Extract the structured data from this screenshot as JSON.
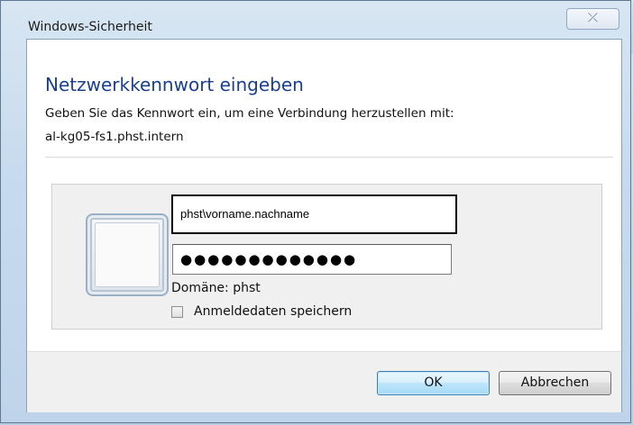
{
  "window": {
    "title": "Windows-Sicherheit",
    "close_glyph": "⤫"
  },
  "dialog": {
    "heading": "Netzwerkkennwort eingeben",
    "description_line1": "Geben Sie das Kennwort ein, um eine Verbindung herzustellen mit:",
    "description_line2": "al-kg05-fs1.phst.intern"
  },
  "credentials": {
    "user_icon": "user-tile-icon",
    "username_value": "phst\\vorname.nachname",
    "password_masked": "●●●●●●●●●●●●●",
    "domain_label": "Domäne: phst",
    "remember_label": "Anmeldedaten speichern",
    "remember_checked": false
  },
  "buttons": {
    "ok_label": "OK",
    "cancel_label": "Abbrechen"
  },
  "colors": {
    "heading": "#1b3f8f",
    "ok_border": "#3c7fb1",
    "frame": "#5f7993"
  }
}
